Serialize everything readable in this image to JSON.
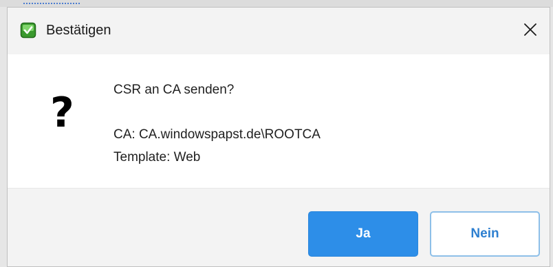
{
  "dialog": {
    "title": "Bestätigen",
    "app_icon": "green-certificate-icon",
    "close_icon": "close-icon"
  },
  "message": {
    "icon": "question-icon",
    "icon_glyph": "?",
    "question": "CSR an CA senden?",
    "ca_line": "CA: CA.windowspapst.de\\ROOTCA",
    "template_line": "Template: Web"
  },
  "buttons": {
    "yes_label": "Ja",
    "no_label": "Nein"
  },
  "colors": {
    "primary_button": "#2d8ee8",
    "secondary_button_text": "#2d7fd0",
    "titlebar_bg": "#f3f3f3"
  }
}
